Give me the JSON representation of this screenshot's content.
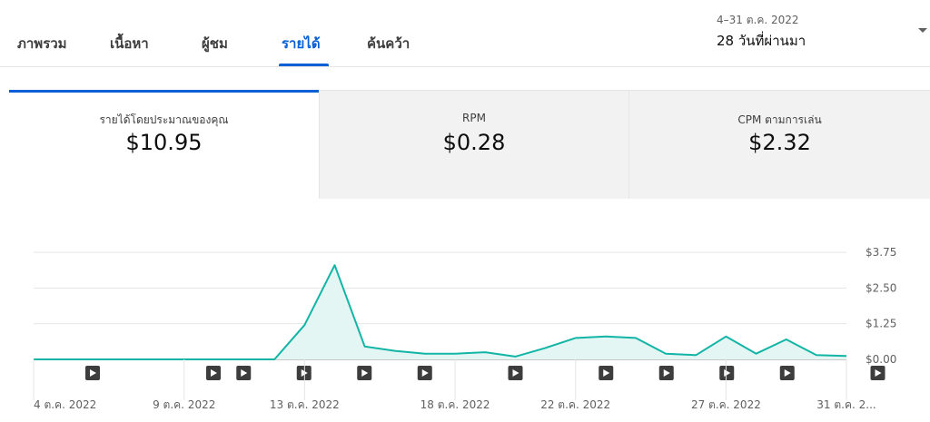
{
  "tabs": [
    {
      "label": "ภาพรวม",
      "active": false
    },
    {
      "label": "เนื้อหา",
      "active": false
    },
    {
      "label": "ผู้ชม",
      "active": false
    },
    {
      "label": "รายได้",
      "active": true
    },
    {
      "label": "ค้นคว้า",
      "active": false
    }
  ],
  "date_selector": {
    "range": "4–31 ต.ค. 2022",
    "period": "28 วันที่ผ่านมา",
    "icon": "dropdown-arrow-icon"
  },
  "metrics": [
    {
      "label": "รายได้โดยประมาณของคุณ",
      "value": "$10.95",
      "selected": true
    },
    {
      "label": "RPM",
      "value": "$0.28",
      "selected": false
    },
    {
      "label": "CPM ตามการเล่น",
      "value": "$2.32",
      "selected": false
    }
  ],
  "colors": {
    "accent": "#065fd4",
    "line": "#12b5a5",
    "fill": "#e3f6f4"
  },
  "chart_data": {
    "type": "area",
    "x": [
      "4 ต.ค. 2022",
      "5 ต.ค. 2022",
      "6 ต.ค. 2022",
      "7 ต.ค. 2022",
      "8 ต.ค. 2022",
      "9 ต.ค. 2022",
      "10 ต.ค. 2022",
      "11 ต.ค. 2022",
      "12 ต.ค. 2022",
      "13 ต.ค. 2022",
      "14 ต.ค. 2022",
      "15 ต.ค. 2022",
      "16 ต.ค. 2022",
      "17 ต.ค. 2022",
      "18 ต.ค. 2022",
      "19 ต.ค. 2022",
      "20 ต.ค. 2022",
      "21 ต.ค. 2022",
      "22 ต.ค. 2022",
      "23 ต.ค. 2022",
      "24 ต.ค. 2022",
      "25 ต.ค. 2022",
      "26 ต.ค. 2022",
      "27 ต.ค. 2022",
      "28 ต.ค. 2022",
      "29 ต.ค. 2022",
      "30 ต.ค. 2022",
      "31 ต.ค. 2022"
    ],
    "series": [
      {
        "values": [
          0,
          0,
          0,
          0,
          0,
          0,
          0,
          0,
          0,
          1.2,
          3.3,
          0.45,
          0.3,
          0.2,
          0.2,
          0.25,
          0.1,
          0.4,
          0.75,
          0.8,
          0.75,
          0.2,
          0.15,
          0.8,
          0.2,
          0.7,
          0.15,
          0.12
        ]
      }
    ],
    "ylim": [
      0,
      3.75
    ],
    "yticks": [
      "$0.00",
      "$1.25",
      "$2.50",
      "$3.75"
    ],
    "ytick_values": [
      0,
      1.25,
      2.5,
      3.75
    ],
    "xticks": [
      {
        "label": "4 ต.ค. 2022",
        "index": 0
      },
      {
        "label": "9 ต.ค. 2022",
        "index": 5
      },
      {
        "label": "13 ต.ค. 2022",
        "index": 9
      },
      {
        "label": "18 ต.ค. 2022",
        "index": 14
      },
      {
        "label": "22 ต.ค. 2022",
        "index": 18
      },
      {
        "label": "27 ต.ค. 2022",
        "index": 23
      },
      {
        "label": "31 ต.ค. 2...",
        "index": 27
      }
    ],
    "video_markers": [
      2,
      6,
      7,
      9,
      11,
      13,
      16,
      19,
      21,
      23,
      25,
      28
    ],
    "marker_icon": "play-icon",
    "grid": true
  }
}
